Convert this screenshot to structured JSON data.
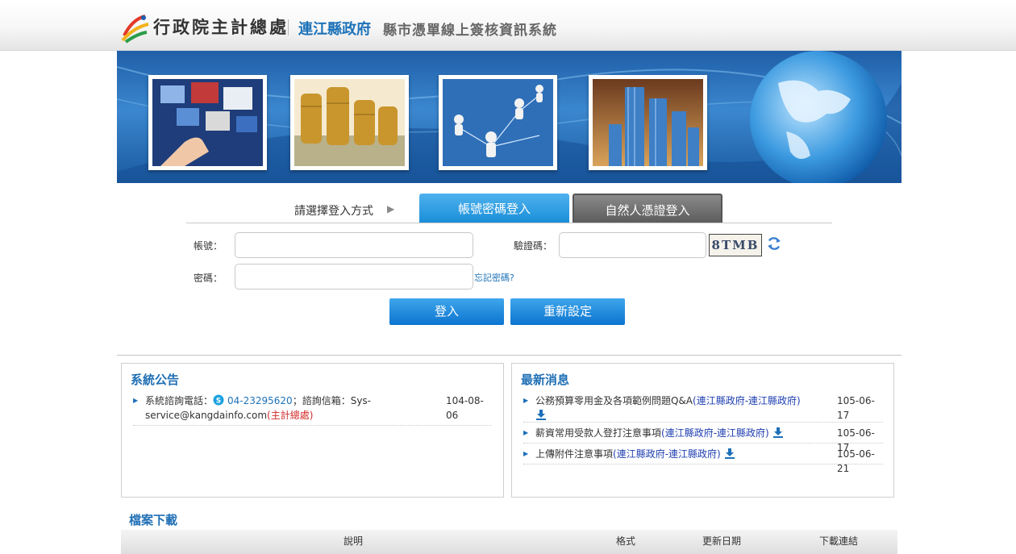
{
  "header": {
    "agency_name": "行政院主計總處",
    "county_name": "連江縣政府",
    "system_title": "縣市憑單線上簽核資訊系統"
  },
  "login": {
    "prompt": "請選擇登入方式",
    "tabs": [
      {
        "label": "帳號密碼登入",
        "active": true
      },
      {
        "label": "自然人憑證登入",
        "active": false
      }
    ],
    "account_label": "帳號：",
    "account_value": "",
    "password_label": "密碼：",
    "password_value": "",
    "captcha_label": "驗證碼：",
    "captcha_value": "",
    "captcha_text": "8TMB",
    "forgot_link": "忘記密碼?",
    "login_button": "登入",
    "reset_button": "重新設定"
  },
  "announcements": {
    "title": "系統公告",
    "items": [
      {
        "prefix": "系統諮詢電話：",
        "phone": "04-23295620",
        "middle": "；諮詢信箱：Sys-",
        "line2": "service@kangdainfo.com",
        "source": "(主計總處)",
        "date": "104-08-06"
      }
    ]
  },
  "news": {
    "title": "最新消息",
    "items": [
      {
        "text": "公務預算零用金及各項範例問題Q&A",
        "source": "(連江縣政府-連江縣政府)",
        "date": "105-06-17"
      },
      {
        "text": "薪資常用受款人登打注意事項",
        "source": "(連江縣政府-連江縣政府)",
        "date": "105-06-17"
      },
      {
        "text": "上傳附件注意事項",
        "source": "(連江縣政府-連江縣政府)",
        "date": "105-06-21"
      }
    ]
  },
  "downloads": {
    "title": "檔案下載",
    "columns": [
      "說明",
      "格式",
      "更新日期",
      "下載連結"
    ]
  },
  "colors": {
    "accent_blue": "#1d72b8",
    "tab_active": "#1a8fd9",
    "tab_inactive": "#5c5c5c",
    "source_red": "#d42a2a"
  },
  "icons": {
    "refresh": "refresh-icon",
    "download": "download-icon",
    "phone": "skype-icon",
    "bullet": "triangle-bullet-icon"
  }
}
